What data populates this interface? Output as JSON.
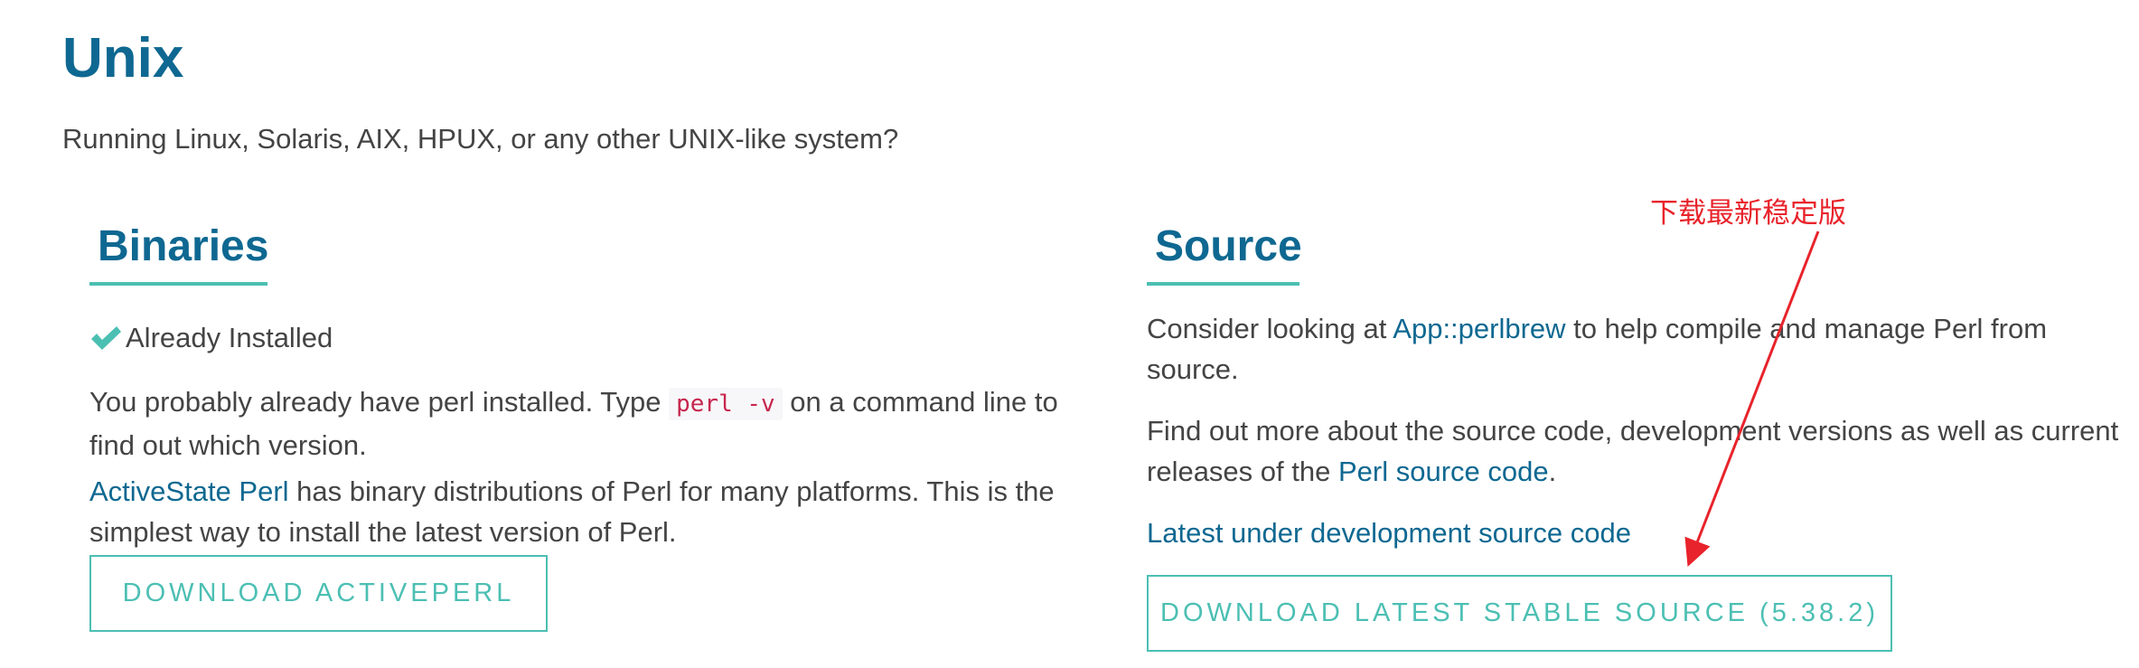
{
  "header": {
    "title": "Unix",
    "subtitle": "Running Linux, Solaris, AIX, HPUX, or any other UNIX-like system?"
  },
  "binaries": {
    "heading": "Binaries",
    "installed_label": "Already Installed",
    "check_icon": "check-icon",
    "para1_before": "You probably already have perl installed. Type ",
    "para1_code": "perl -v",
    "para1_after": " on a command line to",
    "para1_line2": "find out which version.",
    "para2_link": "ActiveState Perl",
    "para2_after": " has binary distributions of Perl for many platforms. This is the",
    "para2_line2": "simplest way to install the latest version of Perl.",
    "button_label": "DOWNLOAD ACTIVEPERL"
  },
  "source": {
    "heading": "Source",
    "para1_before": "Consider looking at ",
    "para1_link": "App::perlbrew",
    "para1_after": " to help compile and manage Perl from",
    "para1_line2": "source.",
    "para2_line1": "Find out more about the source code, development versions as well as current",
    "para2_before": "releases of the ",
    "para2_link": "Perl source code",
    "para2_after": ".",
    "dev_link": "Latest under development source code",
    "button_label": "DOWNLOAD LATEST STABLE SOURCE (5.38.2)"
  },
  "annotation": {
    "label": "下载最新稳定版",
    "color": "#e8232b"
  },
  "colors": {
    "heading": "#0e6891",
    "accent": "#4cbfb3",
    "text": "#444444",
    "code": "#c7254e"
  }
}
